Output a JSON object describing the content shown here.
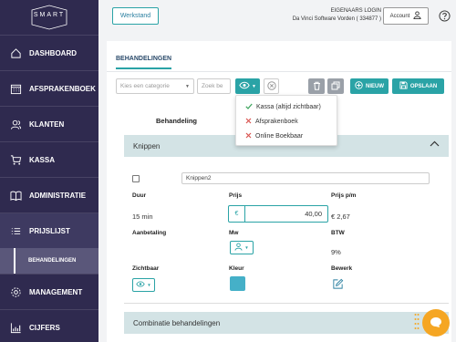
{
  "sidebar": {
    "logo_text": "SMART",
    "items": [
      {
        "label": "DASHBOARD",
        "icon": "home-icon"
      },
      {
        "label": "AFSPRAKENBOEK",
        "icon": "calendar-icon"
      },
      {
        "label": "KLANTEN",
        "icon": "users-icon"
      },
      {
        "label": "KASSA",
        "icon": "cart-icon"
      },
      {
        "label": "ADMINISTRATIE",
        "icon": "book-icon"
      },
      {
        "label": "PRIJSLIJST",
        "icon": "list-icon"
      },
      {
        "label": "MANAGEMENT",
        "icon": "gear-icon"
      },
      {
        "label": "CIJFERS",
        "icon": "chart-icon"
      }
    ],
    "sub_item": "BEHANDELINGEN"
  },
  "header": {
    "werkstand": "Werkstand",
    "login_line1": "EIGENAARS LOGIN",
    "login_line2": "Da Vinci Software Vorden ( 334877 )",
    "account": "Account"
  },
  "tabs": {
    "active": "BEHANDELINGEN"
  },
  "toolbar": {
    "category_placeholder": "Kies een categorie",
    "search_placeholder": "Zoek be",
    "new_label": "NIEUW",
    "save_label": "OPSLAAN"
  },
  "popup": {
    "items": [
      {
        "label": "Kassa (altijd zichtbaar)",
        "state": "checked"
      },
      {
        "label": "Afsprakenboek",
        "state": "unchecked"
      },
      {
        "label": "Online Boekbaar",
        "state": "unchecked"
      }
    ]
  },
  "content": {
    "column_heading": "Behandeling",
    "section1": "Knippen",
    "name_value": "Knippen2",
    "labels": {
      "duur": "Duur",
      "prijs": "Prijs",
      "prijs_pm": "Prijs p/m",
      "aanbetaling": "Aanbetaling",
      "mw": "Mw",
      "btw": "BTW",
      "zichtbaar": "Zichtbaar",
      "kleur": "Kleur",
      "bewerk": "Bewerk"
    },
    "duur_value": "15 min",
    "price_prefix": "€",
    "price_value": "40,00",
    "prijs_pm_value": "€ 2,67",
    "btw_value": "9%",
    "section2": "Combinatie behandelingen"
  },
  "colors": {
    "sidebar_bg": "#2f2a4f",
    "accent": "#2aa3a6",
    "section_bg": "#d3e3e5",
    "chat": "#f5a623",
    "swatch": "#45b0c8"
  }
}
